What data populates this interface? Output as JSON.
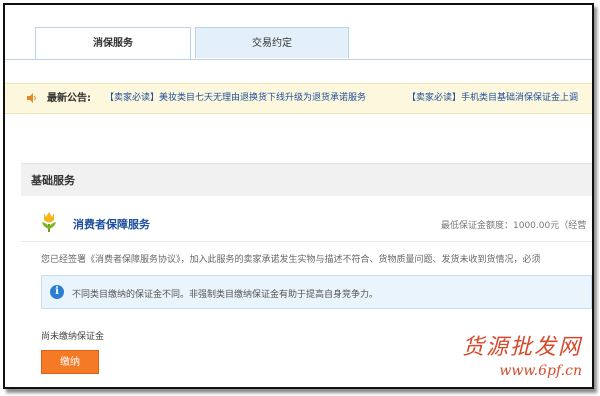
{
  "tabs": [
    {
      "label": "消保服务",
      "active": true
    },
    {
      "label": "交易约定",
      "active": false
    }
  ],
  "notice": {
    "label": "最新公告:",
    "items": [
      "【卖家必读】美妆类目七天无理由退换货下线升级为退货承诺服务",
      "【卖家必读】手机类目基础消保保证金上调"
    ]
  },
  "section": {
    "title": "基础服务"
  },
  "service": {
    "title": "消费者保障服务",
    "quota": "最低保证金额度：1000.00元（经营",
    "agreement": "您已经签署《消费者保障服务协议》，加入此服务的卖家承诺发生实物与描述不符合、货物质量问题、发货未收到货情况，必须"
  },
  "info": {
    "text": "不同类目缴纳的保证金不同。非强制类目缴纳保证金有助于提高自身竞争力。"
  },
  "deposit": {
    "status": "尚未缴纳保证金",
    "button": "缴纳"
  },
  "watermark": {
    "brand": "货源批发网",
    "url": "www.6pf.cn"
  },
  "colors": {
    "accent": "#f47a26",
    "link": "#1d4e9b",
    "info_blue": "#2a7fd3",
    "watermark": "#d64a2b"
  }
}
